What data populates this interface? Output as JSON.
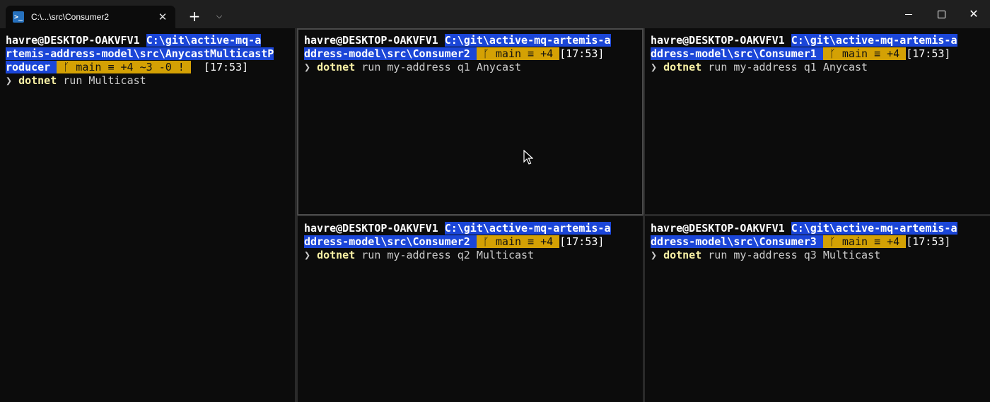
{
  "window": {
    "tab_title": "C:\\...\\src\\Consumer2",
    "tab_icon": "powershell-icon",
    "tab_close": "✕",
    "new_tab": "+",
    "dropdown": "⌵",
    "close": "✕"
  },
  "colors": {
    "path_bg": "#1b46d8",
    "git_bg": "#d4a104",
    "terminal_bg": "#0c0c0c",
    "command": "#f9f1a5"
  },
  "panes": {
    "left": {
      "user": "havre@DESKTOP-OAKVFV1 ",
      "path_1": "C:\\git\\active-mq-a",
      "path_2": "rtemis-address-model\\src\\AnycastMulticastP",
      "path_3": "roducer ",
      "git": " ᚴ main ≡ +4 ~3 -0 ! ",
      "time": "  [17:53]",
      "cmd": "dotnet",
      "args": " run Multicast"
    },
    "top_middle": {
      "user": "havre@DESKTOP-OAKVFV1 ",
      "path_1": "C:\\git\\active-mq-artemis-a",
      "path_2": "ddress-model\\src\\Consumer2 ",
      "git": " ᚴ main ≡ +4 ",
      "time": "[17:53]",
      "cmd": "dotnet",
      "args": " run my-address q1 Anycast"
    },
    "top_right": {
      "user": "havre@DESKTOP-OAKVFV1 ",
      "path_1": "C:\\git\\active-mq-artemis-a",
      "path_2": "ddress-model\\src\\Consumer1 ",
      "git": " ᚴ main ≡ +4 ",
      "time": "[17:53]",
      "cmd": "dotnet",
      "args": " run my-address q1 Anycast"
    },
    "bottom_middle": {
      "user": "havre@DESKTOP-OAKVFV1 ",
      "path_1": "C:\\git\\active-mq-artemis-a",
      "path_2": "ddress-model\\src\\Consumer2 ",
      "git": " ᚴ main ≡ +4 ",
      "time": "[17:53]",
      "cmd": "dotnet",
      "args": " run my-address q2 Multicast"
    },
    "bottom_right": {
      "user": "havre@DESKTOP-OAKVFV1 ",
      "path_1": "C:\\git\\active-mq-artemis-a",
      "path_2": "ddress-model\\src\\Consumer3 ",
      "git": " ᚴ main ≡ +4 ",
      "time": "[17:53]",
      "cmd": "dotnet",
      "args": " run my-address q3 Multicast"
    }
  },
  "glyphs": {
    "arrow": "",
    "prompt_chevron": "❯"
  }
}
